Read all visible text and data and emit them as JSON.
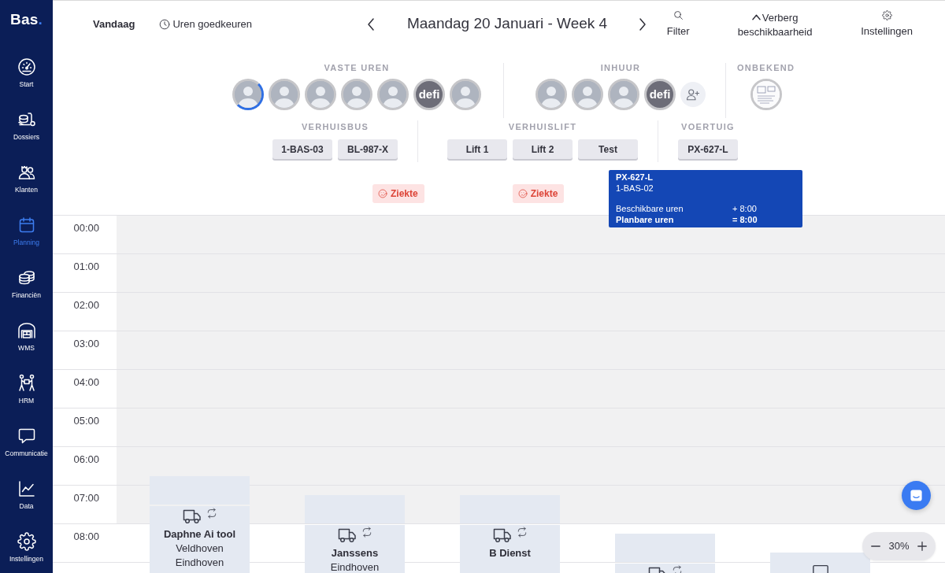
{
  "sidebar": {
    "logo": {
      "text": "Bas",
      "accent": "."
    },
    "items": [
      {
        "label": "Start",
        "selected": false
      },
      {
        "label": "Dossiers",
        "selected": false
      },
      {
        "label": "Klanten",
        "selected": false
      },
      {
        "label": "Planning",
        "selected": true
      },
      {
        "label": "Financiën",
        "selected": false
      },
      {
        "label": "WMS",
        "selected": false
      },
      {
        "label": "HRM",
        "selected": false
      },
      {
        "label": "Communicatie",
        "selected": false
      },
      {
        "label": "Data",
        "selected": false
      },
      {
        "label": "Instellingen",
        "selected": false
      }
    ]
  },
  "toolbar": {
    "today": "Vandaag",
    "approve_hours": "Uren goedkeuren",
    "title": "Maandag 20 Januari - Week 4",
    "filter": "Filter",
    "hide_availability": "Verberg beschikbaarheid",
    "settings": "Instellingen"
  },
  "staff_groups": [
    {
      "title": "VASTE UREN",
      "members": [
        {
          "kind": "photo",
          "selected": true
        },
        {
          "kind": "photo",
          "selected": false
        },
        {
          "kind": "photo",
          "selected": false
        },
        {
          "kind": "photo",
          "selected": false
        },
        {
          "kind": "photo",
          "selected": false
        },
        {
          "kind": "fallback",
          "text": "defi",
          "selected": false
        },
        {
          "kind": "photo",
          "selected": false
        }
      ]
    },
    {
      "title": "INHUUR",
      "can_add": true,
      "members": [
        {
          "kind": "photo",
          "selected": false
        },
        {
          "kind": "photo",
          "selected": false
        },
        {
          "kind": "photo",
          "selected": false
        },
        {
          "kind": "fallback",
          "text": "defi",
          "selected": false
        }
      ]
    },
    {
      "title": "ONBEKEND",
      "members": [
        {
          "kind": "document",
          "selected": false
        }
      ]
    }
  ],
  "resource_groups": [
    {
      "title": "VERHUISBUS",
      "items": [
        "1-BAS-03",
        "BL-987-X"
      ]
    },
    {
      "title": "VERHUISLIFT",
      "items": [
        "Lift 1",
        "Lift 2",
        "Test"
      ]
    },
    {
      "title": "VOERTUIG",
      "items": [
        "PX-627-L"
      ]
    }
  ],
  "absences": [
    {
      "label": "Ziekte"
    },
    {
      "label": "Ziekte"
    }
  ],
  "tooltip": {
    "title": "PX-627-L",
    "subtitle": "1-BAS-02",
    "rows": [
      {
        "label": "Beschikbare uren",
        "value": "+ 8:00",
        "bold": false
      },
      {
        "label": "Planbare uren",
        "value": "= 8:00",
        "bold": true
      }
    ]
  },
  "calendar": {
    "hours": [
      {
        "label": "00:00",
        "shaded": true
      },
      {
        "label": "01:00",
        "shaded": true
      },
      {
        "label": "02:00",
        "shaded": true
      },
      {
        "label": "03:00",
        "shaded": true
      },
      {
        "label": "04:00",
        "shaded": true
      },
      {
        "label": "05:00",
        "shaded": true
      },
      {
        "label": "06:00",
        "shaded": true
      },
      {
        "label": "07:00",
        "shaded": true
      },
      {
        "label": "08:00",
        "shaded": false
      },
      {
        "shaded": false
      }
    ],
    "events": [
      {
        "kind": "move",
        "travel": true,
        "recurring": true,
        "title": "Daphne Ai tool",
        "lines": [
          "Veldhoven",
          "Eindhoven"
        ]
      },
      {
        "kind": "move",
        "travel": true,
        "recurring": true,
        "title": "Janssens",
        "lines": [
          "Eindhoven"
        ]
      },
      {
        "kind": "move",
        "travel": true,
        "recurring": true,
        "title": "B Dienst"
      },
      {
        "kind": "move",
        "travel": true,
        "recurring": true
      },
      {
        "kind": "task",
        "travel": false
      }
    ]
  },
  "zoom": {
    "value": "30%"
  }
}
